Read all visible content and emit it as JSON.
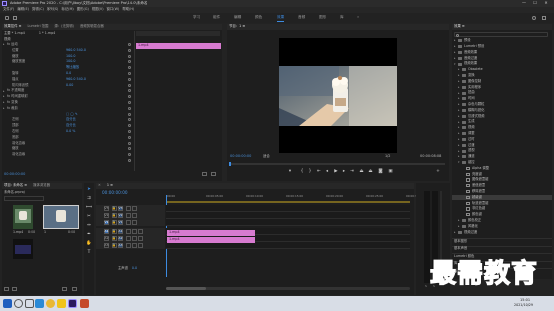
{
  "app": {
    "title": "Adobe Premiere Pro 2020 - C:\\用户\\Jiboy\\文档\\Adobe\\Premiere Pro\\14.0\\未命名",
    "minimize": "—",
    "maximize": "☐",
    "close": "✕"
  },
  "menu": [
    "文件(F)",
    "编辑(E)",
    "剪辑(C)",
    "序列(S)",
    "标记(M)",
    "图形(G)",
    "视图(V)",
    "窗口(W)",
    "帮助(H)"
  ],
  "workspaces": [
    {
      "label": "学习",
      "active": false
    },
    {
      "label": "组件",
      "active": false
    },
    {
      "label": "编辑",
      "active": false
    },
    {
      "label": "颜色",
      "active": false
    },
    {
      "label": "效果",
      "active": true
    },
    {
      "label": "音频",
      "active": false
    },
    {
      "label": "图形",
      "active": false
    },
    {
      "label": "库",
      "active": false
    }
  ],
  "effect_controls": {
    "tabs": [
      "效果控件 ≡",
      "Lumetri 范围",
      "源：(无剪辑)",
      "音频剪辑混合器"
    ],
    "source": "主要 * 1.mp4",
    "seq": "1 * 1.mp4",
    "video_header": "视频",
    "rows": [
      {
        "label": "fx  运动",
        "indent": 2,
        "value": ""
      },
      {
        "label": "位置",
        "indent": 7,
        "value": "960.0    540.0"
      },
      {
        "label": "缩放",
        "indent": 7,
        "value": "100.0"
      },
      {
        "label": "缩放宽度",
        "indent": 7,
        "value": "100.0"
      },
      {
        "label": "",
        "indent": 7,
        "value": "等比缩放"
      },
      {
        "label": "旋转",
        "indent": 7,
        "value": "0.0"
      },
      {
        "label": "锚点",
        "indent": 7,
        "value": "960.0    540.0"
      },
      {
        "label": "防闪烁滤镜",
        "indent": 7,
        "value": "0.00"
      },
      {
        "label": "fx  不透明度",
        "indent": 2,
        "value": ""
      },
      {
        "label": "fx  时间重映射",
        "indent": 2,
        "value": ""
      },
      {
        "label": "fx  变换",
        "indent": 2,
        "value": ""
      },
      {
        "label": "fx  裁剪",
        "indent": 2,
        "value": ""
      },
      {
        "label": "",
        "indent": 7,
        "value": "□ ◯ ✎"
      },
      {
        "label": "左侧",
        "indent": 7,
        "value": "百分比"
      },
      {
        "label": "顶部",
        "indent": 7,
        "value": "百分比"
      },
      {
        "label": "右侧",
        "indent": 7,
        "value": "0.0 %"
      },
      {
        "label": "底部",
        "indent": 7,
        "value": ""
      },
      {
        "label": "羽化边缘",
        "indent": 7,
        "value": ""
      },
      {
        "label": "缩放",
        "indent": 7,
        "value": ""
      },
      {
        "label": "羽化边缘",
        "indent": 7,
        "value": ""
      },
      {
        "label": "",
        "indent": 7,
        "value": ""
      }
    ],
    "clip_label": "1.mp4",
    "timecode": "00:00:00:00"
  },
  "program": {
    "title": "节目：1 ≡",
    "timecode": "00:00:00:00",
    "fit": "适合",
    "quality": "1/2",
    "duration": "00:00:08:08"
  },
  "effects_panel": {
    "title": "效果 ≡",
    "items": [
      {
        "label": "预设",
        "type": "folder",
        "indent": 0
      },
      {
        "label": "Lumetri 预设",
        "type": "folder",
        "indent": 0
      },
      {
        "label": "音频效果",
        "type": "folder",
        "indent": 0
      },
      {
        "label": "音频过渡",
        "type": "folder",
        "indent": 0
      },
      {
        "label": "视频效果",
        "type": "folder",
        "indent": 0
      },
      {
        "label": "Obsolete",
        "type": "folder",
        "indent": 1
      },
      {
        "label": "变换",
        "type": "folder",
        "indent": 1
      },
      {
        "label": "图像控制",
        "type": "folder",
        "indent": 1
      },
      {
        "label": "实用程序",
        "type": "folder",
        "indent": 1
      },
      {
        "label": "扭曲",
        "type": "folder",
        "indent": 1
      },
      {
        "label": "时间",
        "type": "folder",
        "indent": 1
      },
      {
        "label": "杂色与颗粒",
        "type": "folder",
        "indent": 1
      },
      {
        "label": "模糊与锐化",
        "type": "folder",
        "indent": 1
      },
      {
        "label": "沉浸式视频",
        "type": "folder",
        "indent": 1
      },
      {
        "label": "生成",
        "type": "folder",
        "indent": 1
      },
      {
        "label": "视频",
        "type": "folder",
        "indent": 1
      },
      {
        "label": "调整",
        "type": "folder",
        "indent": 1
      },
      {
        "label": "过时",
        "type": "folder",
        "indent": 1
      },
      {
        "label": "过渡",
        "type": "folder",
        "indent": 1
      },
      {
        "label": "透视",
        "type": "folder",
        "indent": 1
      },
      {
        "label": "通道",
        "type": "folder",
        "indent": 1
      },
      {
        "label": "键控",
        "type": "folder",
        "indent": 1
      },
      {
        "label": "Alpha 调整",
        "type": "fx",
        "indent": 2
      },
      {
        "label": "亮度键",
        "type": "fx",
        "indent": 2
      },
      {
        "label": "图像遮罩键",
        "type": "fx",
        "indent": 2
      },
      {
        "label": "差值遮罩",
        "type": "fx",
        "indent": 2
      },
      {
        "label": "移除遮罩",
        "type": "fx",
        "indent": 2
      },
      {
        "label": "超级键",
        "type": "fx",
        "indent": 2
      },
      {
        "label": "轨道遮罩键",
        "type": "fx",
        "indent": 2
      },
      {
        "label": "非红色键",
        "type": "fx",
        "indent": 2
      },
      {
        "label": "颜色键",
        "type": "fx",
        "indent": 2
      },
      {
        "label": "颜色校正",
        "type": "folder",
        "indent": 1
      },
      {
        "label": "风格化",
        "type": "folder",
        "indent": 1
      },
      {
        "label": "视频过渡",
        "type": "folder",
        "indent": 0
      }
    ],
    "lower": [
      "基本图形",
      "基本声音",
      "Lumetri 颜色",
      "库",
      "标记"
    ]
  },
  "project": {
    "tabs": [
      "项目: 未命名 ≡",
      "媒体浏览器"
    ],
    "name": "未命名.prproj",
    "item1_name": "1.mp4",
    "item1_dur": "8:08",
    "item2_name": "1",
    "item2_dur": "8:08"
  },
  "timeline": {
    "tab": "1 ≡",
    "timecode": "00:00:00:00",
    "ruler": [
      ":00:00",
      "00:00:05:00",
      "00:00:10:00",
      "00:00:15:00",
      "00:00:20:00",
      "00:00:25:00",
      "00:00:30:00"
    ],
    "tracks": [
      "V3",
      "V2",
      "V1",
      "A1",
      "A2",
      "A3"
    ],
    "master": "主声道",
    "master_val": "0.0",
    "clip_v": "1.mp4",
    "clip_a": "1.mp4",
    "meter_labels": [
      "S",
      "S"
    ]
  },
  "taskbar": {
    "time": "15:01",
    "date": "2021/10/29"
  },
  "watermark": "最需教育",
  "colors": {
    "accent": "#3d8be0",
    "clip": "#d77bd0",
    "value": "#4a90d9"
  }
}
